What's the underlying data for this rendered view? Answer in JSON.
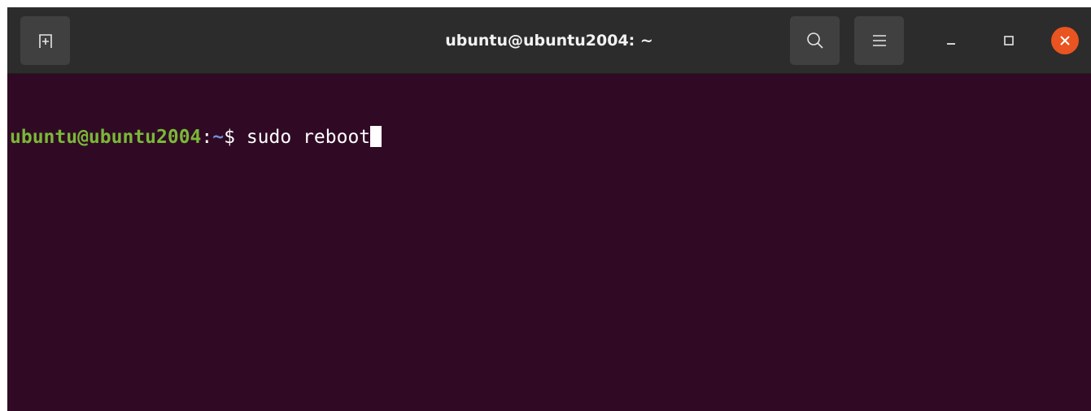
{
  "window": {
    "title": "ubuntu@ubuntu2004: ~"
  },
  "titlebar": {
    "new_tab_icon": "new-tab-icon",
    "search_icon": "search-icon",
    "menu_icon": "hamburger-menu-icon",
    "minimize_icon": "minimize-icon",
    "maximize_icon": "maximize-icon",
    "close_icon": "close-icon"
  },
  "terminal": {
    "prompt_user_host": "ubuntu@ubuntu2004",
    "prompt_colon": ":",
    "prompt_cwd": "~",
    "prompt_dollar": "$",
    "command": " sudo reboot"
  },
  "colors": {
    "terminal_bg": "#300a24",
    "titlebar_bg": "#2c2c2c",
    "button_bg": "#404040",
    "prompt_green": "#7ab838",
    "prompt_blue": "#6f8fd6",
    "close_orange": "#e95420"
  }
}
